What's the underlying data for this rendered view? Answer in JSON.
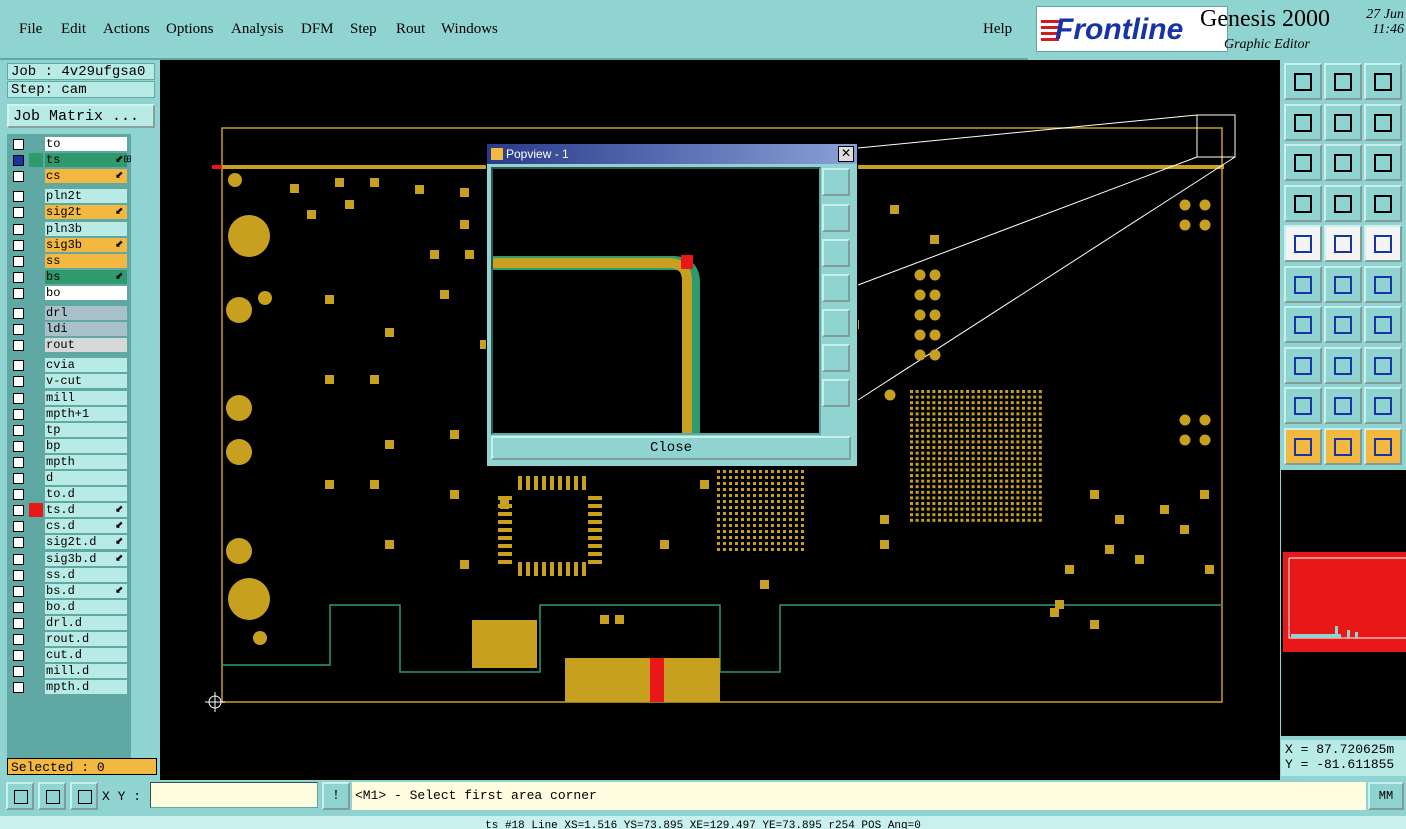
{
  "menubar": {
    "items": [
      "File",
      "Edit",
      "Actions",
      "Options",
      "Analysis",
      "DFM",
      "Step",
      "Rout",
      "Windows"
    ],
    "help": "Help"
  },
  "brand": {
    "logo": "Frontline",
    "product": "Genesis 2000",
    "subtitle": "Graphic Editor",
    "date": "27 Jun",
    "time": "11:46"
  },
  "job": {
    "job_label": "Job : 4v29ufgsa0",
    "step_label": "Step: cam",
    "matrix_button": "Job Matrix ..."
  },
  "layers": [
    {
      "name": "to",
      "color": "#ffffff",
      "swatch": "",
      "mark": ""
    },
    {
      "name": "ts",
      "color": "#2e9a6e",
      "swatch": "#2e9a6e",
      "mark": "⬋⊞",
      "active": true
    },
    {
      "name": "cs",
      "color": "#f2b840",
      "swatch": "",
      "mark": "⬋"
    },
    {
      "name": "pln2t",
      "color": "#b8eae6",
      "swatch": "",
      "mark": ""
    },
    {
      "name": "sig2t",
      "color": "#f2b840",
      "swatch": "",
      "mark": "⬋"
    },
    {
      "name": "pln3b",
      "color": "#b8eae6",
      "swatch": "",
      "mark": ""
    },
    {
      "name": "sig3b",
      "color": "#f2b840",
      "swatch": "",
      "mark": "⬋"
    },
    {
      "name": "ss",
      "color": "#f2b840",
      "swatch": "",
      "mark": ""
    },
    {
      "name": "bs",
      "color": "#2e9a6e",
      "swatch": "",
      "mark": "⬋"
    },
    {
      "name": "bo",
      "color": "#ffffff",
      "swatch": "",
      "mark": ""
    },
    {
      "name": "drl",
      "color": "#a8c0c8",
      "swatch": "",
      "mark": ""
    },
    {
      "name": "ldi",
      "color": "#a8c0c8",
      "swatch": "",
      "mark": ""
    },
    {
      "name": "rout",
      "color": "#d8d8d8",
      "swatch": "",
      "mark": ""
    },
    {
      "name": "cvia",
      "color": "#b8eae6",
      "swatch": "",
      "mark": ""
    },
    {
      "name": "v-cut",
      "color": "#b8eae6",
      "swatch": "",
      "mark": ""
    },
    {
      "name": "mill",
      "color": "#b8eae6",
      "swatch": "",
      "mark": ""
    },
    {
      "name": "mpth+1",
      "color": "#b8eae6",
      "swatch": "",
      "mark": ""
    },
    {
      "name": "tp",
      "color": "#b8eae6",
      "swatch": "",
      "mark": ""
    },
    {
      "name": "bp",
      "color": "#b8eae6",
      "swatch": "",
      "mark": ""
    },
    {
      "name": "mpth",
      "color": "#b8eae6",
      "swatch": "",
      "mark": ""
    },
    {
      "name": "d",
      "color": "#b8eae6",
      "swatch": "",
      "mark": ""
    },
    {
      "name": "to.d",
      "color": "#b8eae6",
      "swatch": "",
      "mark": ""
    },
    {
      "name": "ts.d",
      "color": "#b8eae6",
      "swatch": "#e81818",
      "mark": "⬋"
    },
    {
      "name": "cs.d",
      "color": "#b8eae6",
      "swatch": "",
      "mark": "⬋"
    },
    {
      "name": "sig2t.d",
      "color": "#b8eae6",
      "swatch": "",
      "mark": "⬋"
    },
    {
      "name": "sig3b.d",
      "color": "#b8eae6",
      "swatch": "",
      "mark": "⬋"
    },
    {
      "name": "ss.d",
      "color": "#b8eae6",
      "swatch": "",
      "mark": ""
    },
    {
      "name": "bs.d",
      "color": "#b8eae6",
      "swatch": "",
      "mark": "⬋"
    },
    {
      "name": "bo.d",
      "color": "#b8eae6",
      "swatch": "",
      "mark": ""
    },
    {
      "name": "drl.d",
      "color": "#b8eae6",
      "swatch": "",
      "mark": ""
    },
    {
      "name": "rout.d",
      "color": "#b8eae6",
      "swatch": "",
      "mark": ""
    },
    {
      "name": "cut.d",
      "color": "#b8eae6",
      "swatch": "",
      "mark": ""
    },
    {
      "name": "mill.d",
      "color": "#b8eae6",
      "swatch": "",
      "mark": ""
    },
    {
      "name": "mpth.d",
      "color": "#b8eae6",
      "swatch": "",
      "mark": ""
    }
  ],
  "selected_label": "Selected : 0",
  "popview": {
    "title": "Popview - 1",
    "close_label": "Close"
  },
  "toolbar_icons": [
    "load-icon",
    "save-icon",
    "home-icon",
    "pan-left-icon",
    "pan-right-icon",
    "undo-view-icon",
    "zoom-fit-icon",
    "zoom-center-icon",
    "scale-1-2-icon",
    "measure-icon",
    "probe-icon",
    "netlist-icon",
    "snap-icon",
    "highlight-icon",
    "ruler-icon",
    "connect-icon",
    "cross-icon",
    "vertex-icon",
    "angle-icon",
    "line-icon",
    "rotate-icon",
    "pad-icon",
    "dash-icon",
    "resize-icon",
    "triangle-icon",
    "arc-icon",
    "polygon-icon",
    "select-icon",
    "select-box-icon",
    "select-pad-icon"
  ],
  "coords": {
    "x": "X =  87.720625m",
    "y": "Y = -81.611855"
  },
  "bottom": {
    "xy_label": "X Y :",
    "xy_value": "",
    "prompt": "<M1> - Select first area corner",
    "units": "MM",
    "status": "ts #18 Line XS=1.516 YS=73.895 XE=129.497 YE=73.895 r254 POS Ang=0"
  },
  "colors": {
    "ui_bg": "#8fd4d0",
    "copper": "#c8a020",
    "green": "#2e9a6e",
    "red": "#e81818",
    "outline": "#c8a020"
  }
}
